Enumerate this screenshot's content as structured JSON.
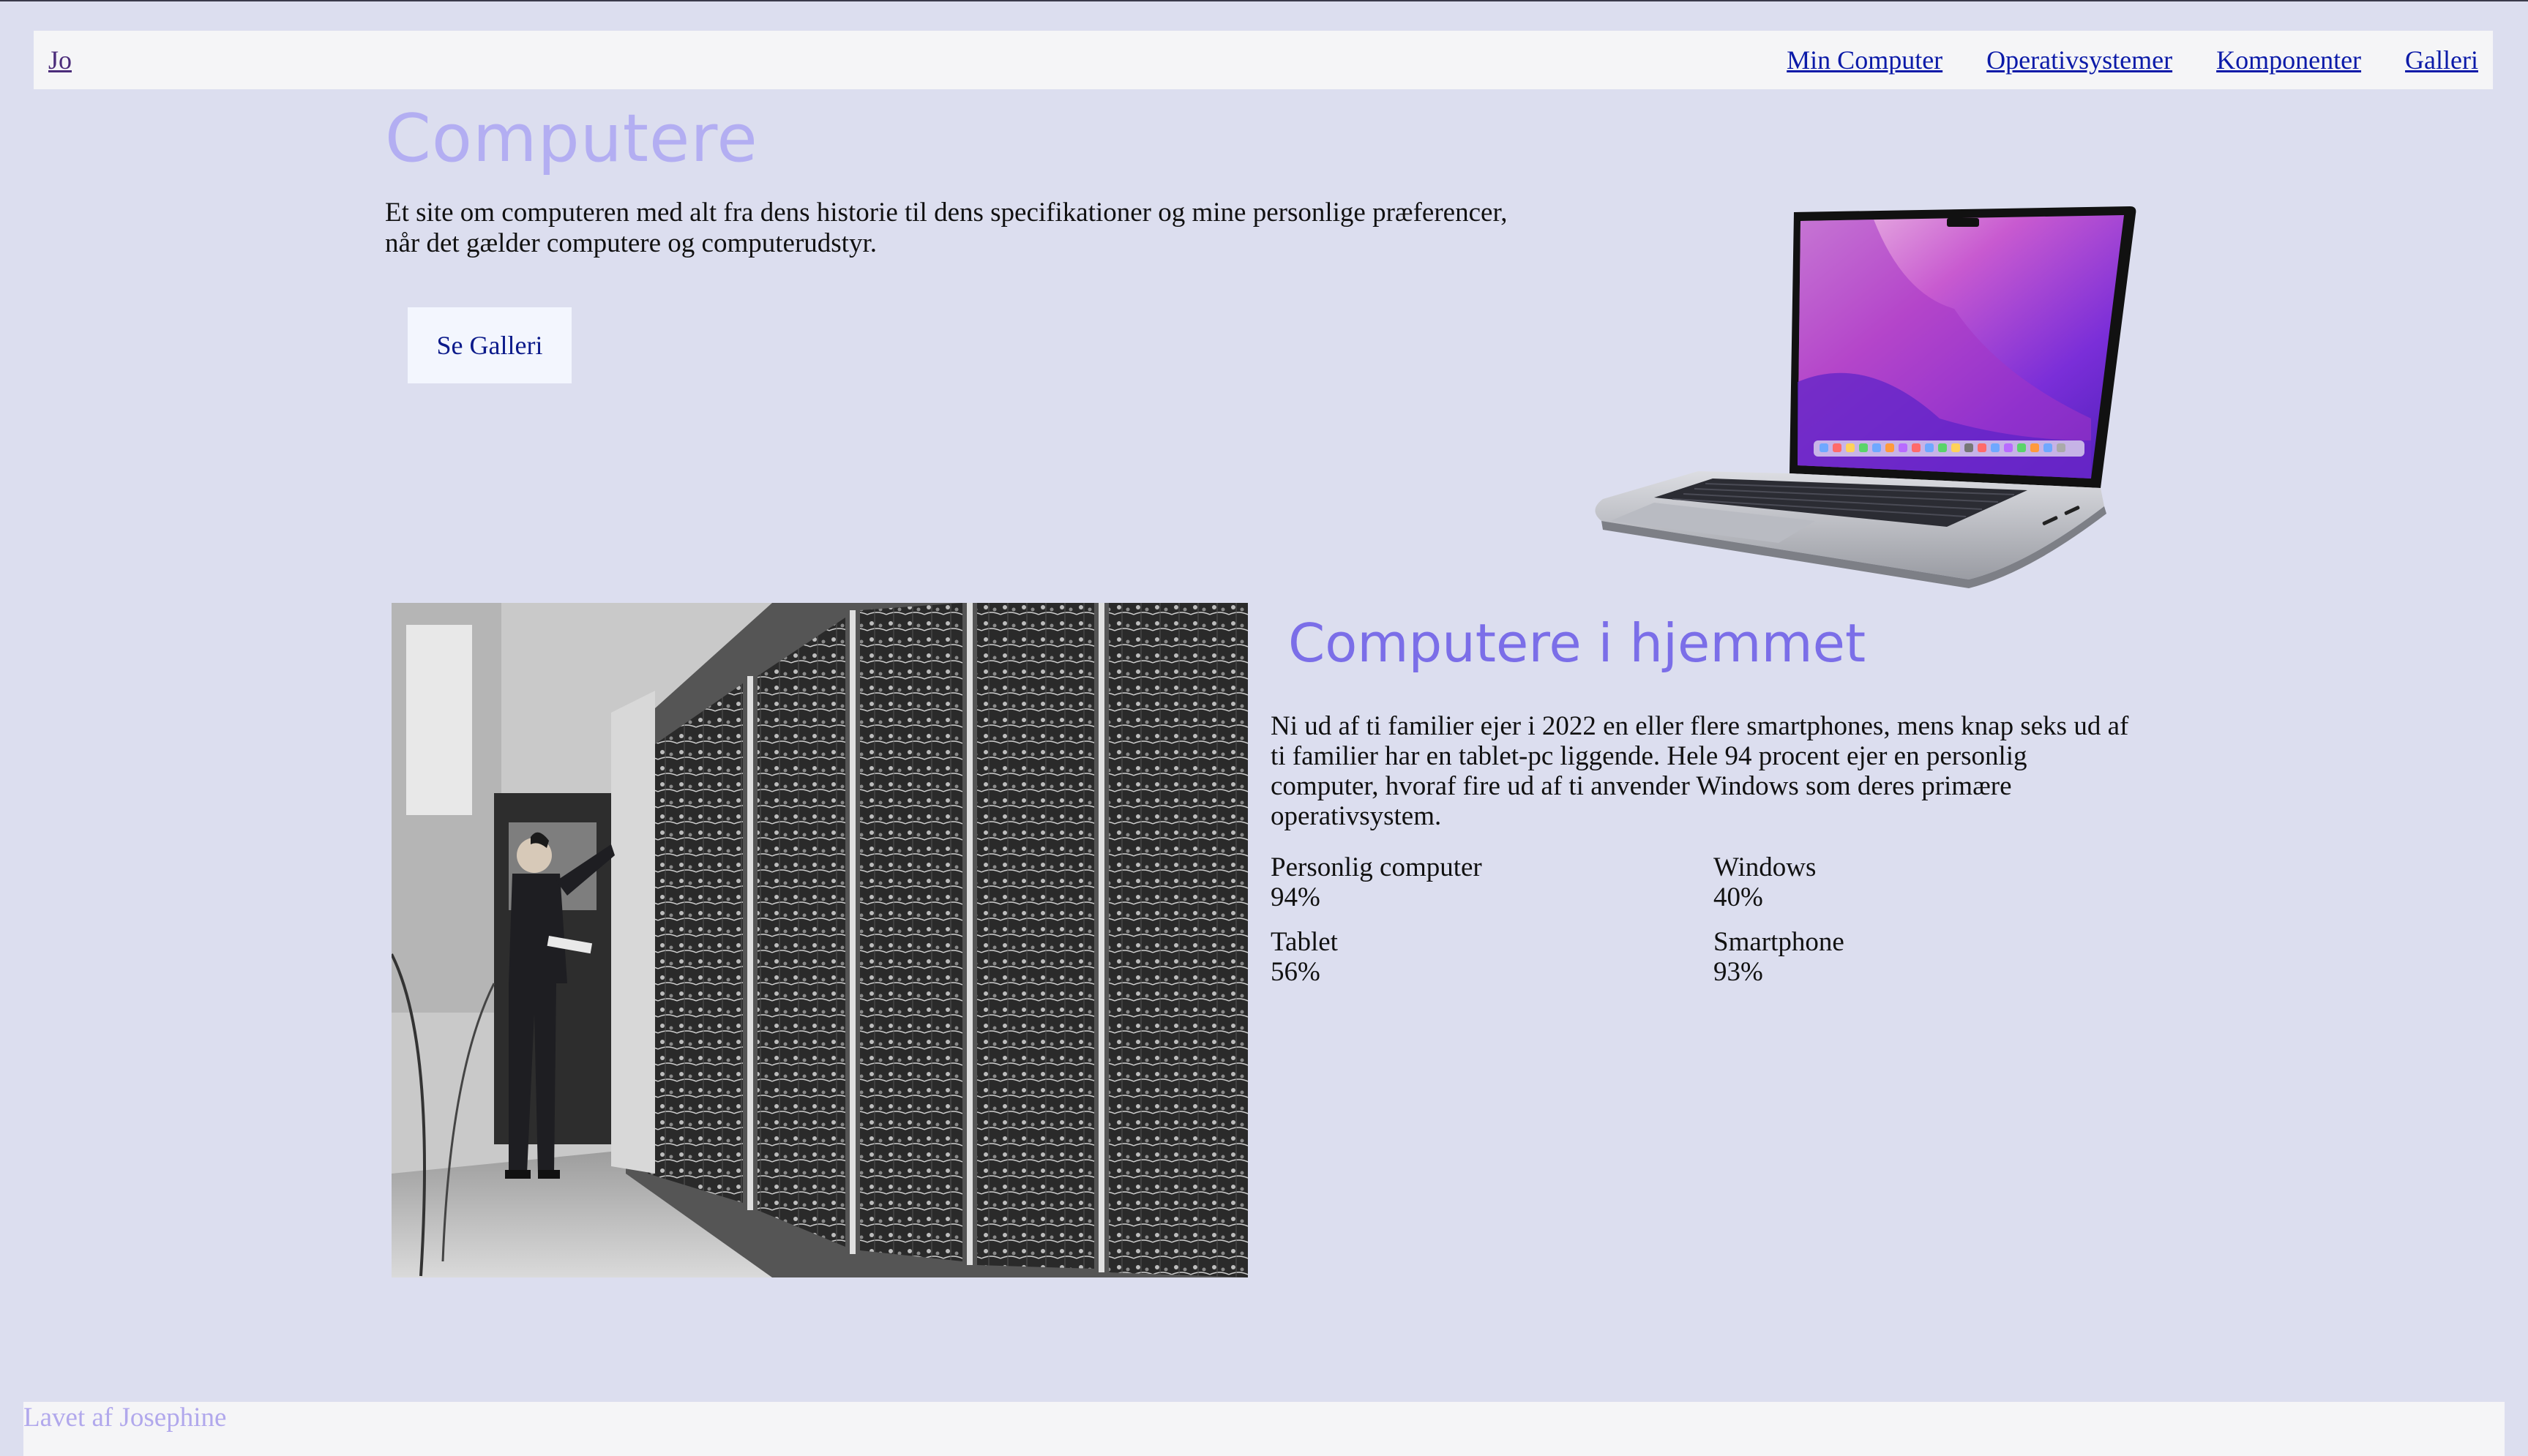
{
  "nav": {
    "brand": "Jo",
    "links": [
      "Min Computer",
      "Operativsystemer",
      "Komponenter",
      "Galleri"
    ]
  },
  "hero": {
    "title": "Computere",
    "text": "Et site om computeren med alt fra dens historie til dens specifikationer og mine personlige præferencer, når det gælder computere og computerudstyr.",
    "button_label": "Se Galleri"
  },
  "section": {
    "title": "Computere i hjemmet",
    "text": "Ni ud af ti familier ejer i 2022 en eller flere smartphones, mens knap seks ud af ti familier har en tablet-pc liggende. Hele 94 procent ejer en personlig computer, hvoraf fire ud af ti anvender Windows som deres primære operativsystem.",
    "stats": [
      {
        "label": "Personlig computer",
        "value": "94%"
      },
      {
        "label": "Windows",
        "value": "40%"
      },
      {
        "label": "Tablet",
        "value": "56%"
      },
      {
        "label": "Smartphone",
        "value": "93%"
      }
    ]
  },
  "footer": {
    "text": "Lavet af Josephine"
  },
  "icons": {
    "laptop": "laptop-image",
    "photo": "vintage-computer-photo"
  },
  "colors": {
    "background": "#dcdeef",
    "nav_background": "#f5f5f7",
    "hero_title": "#b3aef2",
    "section_title": "#7b6ee8",
    "link": "#0b1aa8",
    "button_background": "#f3f6fe",
    "footer_text": "#b1a8ec"
  }
}
